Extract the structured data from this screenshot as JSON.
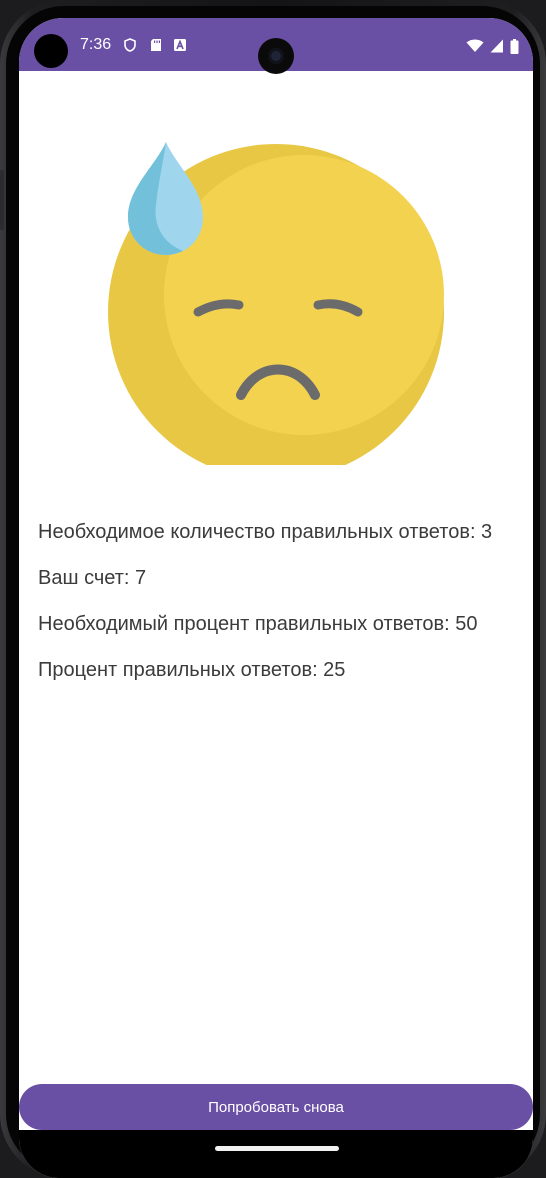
{
  "status_bar": {
    "time": "7:36",
    "background": "#6a50a4",
    "left_icons": [
      "shield-icon",
      "sd-card-icon",
      "a-letter-icon"
    ],
    "right_icons": [
      "wifi-icon",
      "signal-icon",
      "battery-icon"
    ]
  },
  "illustration": {
    "name": "sad-sweat-emoji",
    "face_color": "#f3d250",
    "shade_color": "#e7c744",
    "drop_color": "#7ec8e0"
  },
  "results": {
    "required_correct": "Необходимое количество правильных ответов: 3",
    "score": "Ваш счет: 7",
    "required_percent": "Необходимый процент правильных ответов: 50",
    "percent_correct": "Процент правильных ответов: 25"
  },
  "actions": {
    "retry_label": "Попробовать снова"
  },
  "colors": {
    "accent": "#6a50a4",
    "text": "#3b3b3b"
  }
}
